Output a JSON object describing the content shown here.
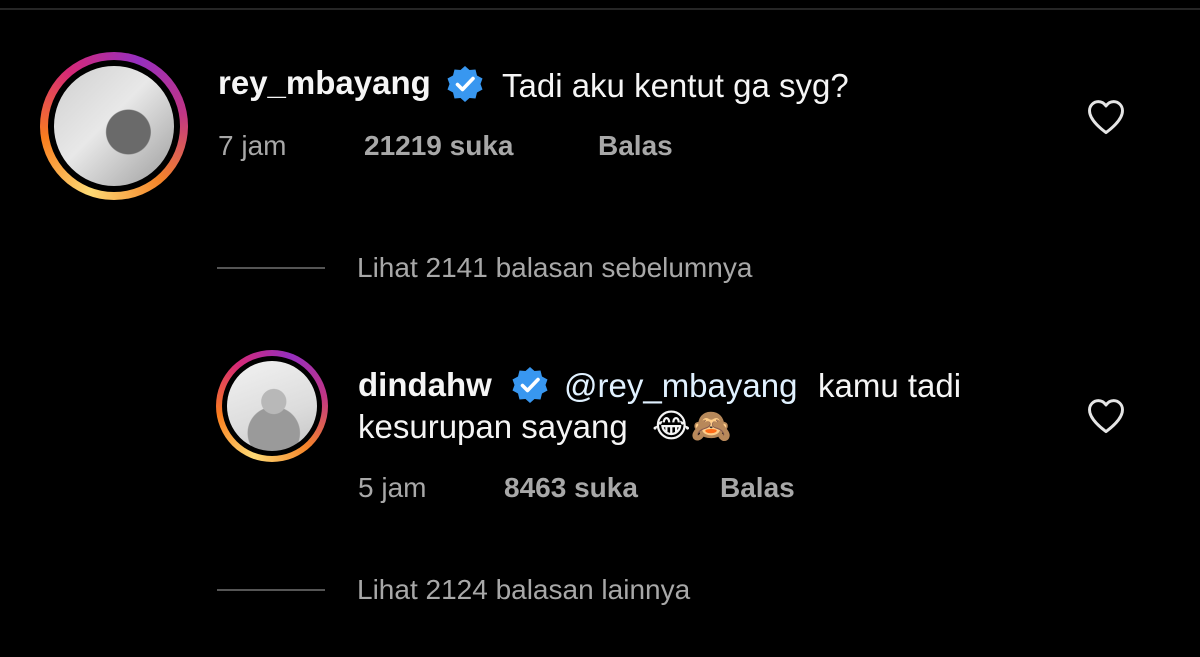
{
  "comments": [
    {
      "username": "rey_mbayang",
      "verified": true,
      "text": "Tadi aku kentut ga syg?",
      "time": "7 jam",
      "likes": "21219 suka",
      "reply_label": "Balas"
    },
    {
      "username": "dindahw",
      "verified": true,
      "mention": "@rey_mbayang",
      "text_line1": "kamu tadi",
      "text_line2": "kesurupan sayang",
      "emoji": "😂🙈",
      "time": "5 jam",
      "likes": "8463 suka",
      "reply_label": "Balas"
    }
  ],
  "view_previous_replies": "Lihat 2141 balasan sebelumnya",
  "view_more_replies": "Lihat 2124 balasan lainnya",
  "colors": {
    "background": "#000000",
    "text": "#f5f5f5",
    "meta": "#a8a8a8",
    "verified": "#3897f0"
  },
  "icons": [
    "verified-badge-icon",
    "heart-outline-icon",
    "story-ring-avatar"
  ]
}
